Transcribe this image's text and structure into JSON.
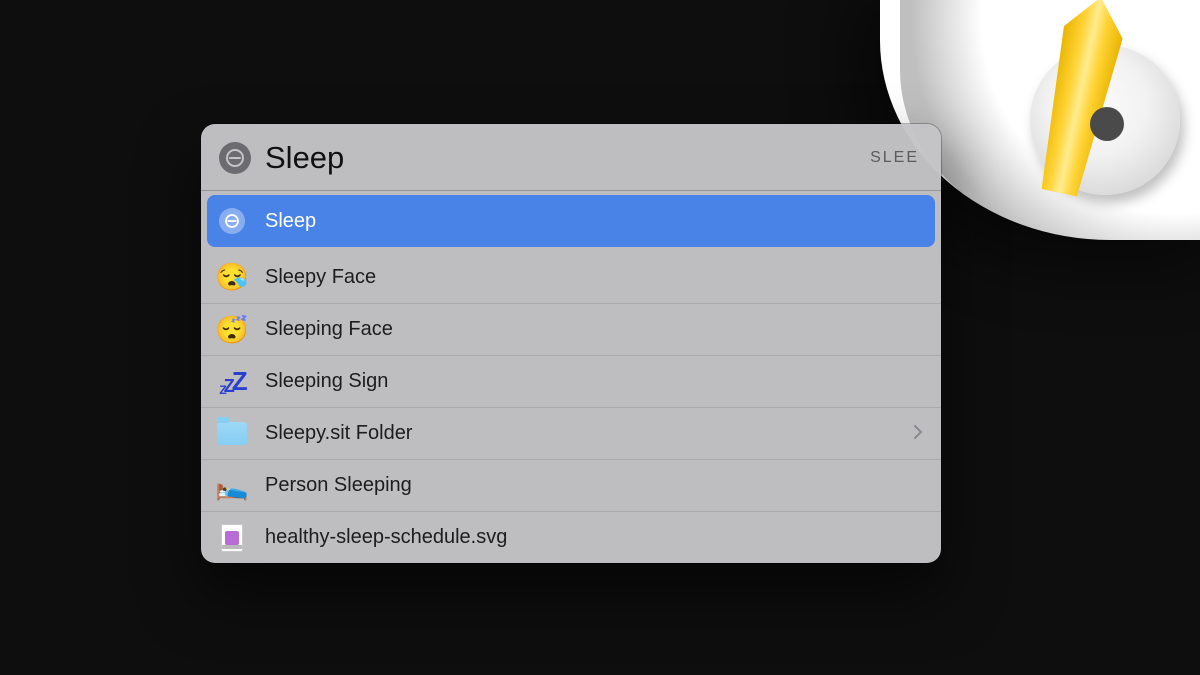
{
  "search": {
    "query": "Sleep",
    "shortcut_hint": "SLEE",
    "icon": "do-not-disturb-icon"
  },
  "results": [
    {
      "icon": "do-not-disturb-icon",
      "label": "Sleep",
      "selected": true,
      "has_chevron": false
    },
    {
      "icon": "sleepy-face-emoji",
      "label": "Sleepy Face",
      "selected": false,
      "has_chevron": false
    },
    {
      "icon": "sleeping-face-emoji",
      "label": "Sleeping Face",
      "selected": false,
      "has_chevron": false
    },
    {
      "icon": "zzz-icon",
      "label": "Sleeping Sign",
      "selected": false,
      "has_chevron": false
    },
    {
      "icon": "folder-icon",
      "label": "Sleepy.sit Folder",
      "selected": false,
      "has_chevron": true
    },
    {
      "icon": "person-in-bed-emoji",
      "label": "Person Sleeping",
      "selected": false,
      "has_chevron": false
    },
    {
      "icon": "svg-file-icon",
      "label": "healthy-sleep-schedule.svg",
      "selected": false,
      "has_chevron": false
    }
  ],
  "colors": {
    "selection": "#4a83e8",
    "panel": "#c4c4c6",
    "accent_yellow": "#ffd233"
  }
}
